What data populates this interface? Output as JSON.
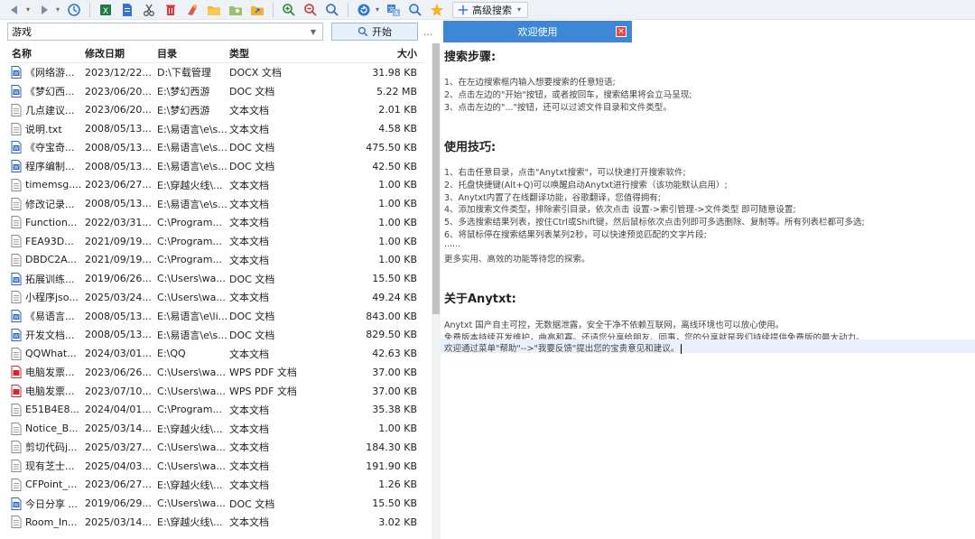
{
  "toolbar": {
    "buttons": [
      {
        "name": "back-icon"
      },
      {
        "name": "forward-icon"
      },
      {
        "name": "history-icon"
      },
      {
        "name": "excel-icon"
      },
      {
        "name": "document-icon"
      },
      {
        "name": "cut-icon"
      },
      {
        "name": "delete-icon"
      },
      {
        "name": "clean-icon"
      },
      {
        "name": "folder-icon"
      },
      {
        "name": "image-folder-icon"
      },
      {
        "name": "export-icon"
      },
      {
        "name": "zoom-in-icon"
      },
      {
        "name": "zoom-out-icon"
      },
      {
        "name": "find-icon"
      },
      {
        "name": "refresh-icon"
      },
      {
        "name": "translate-icon"
      },
      {
        "name": "inspect-icon"
      },
      {
        "name": "favorite-icon"
      }
    ],
    "advanced_search_label": "高级搜索"
  },
  "search": {
    "value": "游戏",
    "start_label": "开始",
    "more_label": "..."
  },
  "tab": {
    "label": "欢迎使用"
  },
  "list": {
    "headers": {
      "name": "名称",
      "date": "修改日期",
      "dir": "目录",
      "type": "类型",
      "size": "大小"
    },
    "rows": [
      {
        "icon": "word",
        "name": "《网络游...",
        "date": "2023/12/22...",
        "dir": "D:\\下载管理",
        "type": "DOCX 文档",
        "size": "31.98 KB"
      },
      {
        "icon": "word",
        "name": "《梦幻西...",
        "date": "2023/06/20...",
        "dir": "E:\\梦幻西游",
        "type": "DOC 文档",
        "size": "5.22 MB"
      },
      {
        "icon": "text",
        "name": "几点建议...",
        "date": "2023/06/20...",
        "dir": "E:\\梦幻西游",
        "type": "文本文档",
        "size": "2.01 KB"
      },
      {
        "icon": "text",
        "name": "说明.txt",
        "date": "2008/05/13...",
        "dir": "E:\\易语言\\e\\s...",
        "type": "文本文档",
        "size": "4.58 KB"
      },
      {
        "icon": "word",
        "name": "《夺宝奇...",
        "date": "2008/05/13...",
        "dir": "E:\\易语言\\e\\s...",
        "type": "DOC 文档",
        "size": "475.50 KB"
      },
      {
        "icon": "word",
        "name": "程序编制...",
        "date": "2008/05/13...",
        "dir": "E:\\易语言\\e\\s...",
        "type": "DOC 文档",
        "size": "42.50 KB"
      },
      {
        "icon": "text",
        "name": "timemsg....",
        "date": "2023/06/27...",
        "dir": "E:\\穿越火线\\...",
        "type": "文本文档",
        "size": "1.00 KB"
      },
      {
        "icon": "text",
        "name": "修改记录...",
        "date": "2008/05/13...",
        "dir": "E:\\易语言\\e\\s...",
        "type": "文本文档",
        "size": "1.00 KB"
      },
      {
        "icon": "text",
        "name": "Function...",
        "date": "2022/03/31...",
        "dir": "C:\\Program...",
        "type": "文本文档",
        "size": "1.00 KB"
      },
      {
        "icon": "text",
        "name": "FEA93D...",
        "date": "2021/09/19...",
        "dir": "C:\\Program...",
        "type": "文本文档",
        "size": "1.00 KB"
      },
      {
        "icon": "text",
        "name": "DBDC2A...",
        "date": "2021/09/19...",
        "dir": "C:\\Program...",
        "type": "文本文档",
        "size": "1.00 KB"
      },
      {
        "icon": "word",
        "name": "拓展训练...",
        "date": "2019/06/26...",
        "dir": "C:\\Users\\wa...",
        "type": "DOC 文档",
        "size": "15.50 KB"
      },
      {
        "icon": "text",
        "name": "小程序jso...",
        "date": "2025/03/24...",
        "dir": "C:\\Users\\wa...",
        "type": "文本文档",
        "size": "49.24 KB"
      },
      {
        "icon": "word",
        "name": "《易语言...",
        "date": "2008/05/13...",
        "dir": "E:\\易语言\\e\\li...",
        "type": "DOC 文档",
        "size": "843.00 KB"
      },
      {
        "icon": "word",
        "name": "开发文档...",
        "date": "2008/05/13...",
        "dir": "E:\\易语言\\e\\s...",
        "type": "DOC 文档",
        "size": "829.50 KB"
      },
      {
        "icon": "text",
        "name": "QQWhat...",
        "date": "2024/03/01...",
        "dir": "E:\\QQ",
        "type": "文本文档",
        "size": "42.63 KB"
      },
      {
        "icon": "pdf",
        "name": "电脑发票...",
        "date": "2023/06/26...",
        "dir": "C:\\Users\\wa...",
        "type": "WPS PDF 文档",
        "size": "37.00 KB"
      },
      {
        "icon": "pdf",
        "name": "电脑发票...",
        "date": "2023/07/10...",
        "dir": "C:\\Users\\wa...",
        "type": "WPS PDF 文档",
        "size": "37.00 KB"
      },
      {
        "icon": "text",
        "name": "E51B4E8...",
        "date": "2024/04/01...",
        "dir": "C:\\Program...",
        "type": "文本文档",
        "size": "35.38 KB"
      },
      {
        "icon": "text",
        "name": "Notice_B...",
        "date": "2025/03/14...",
        "dir": "E:\\穿越火线\\...",
        "type": "文本文档",
        "size": "1.00 KB"
      },
      {
        "icon": "text",
        "name": "剪切代码j...",
        "date": "2025/03/27...",
        "dir": "C:\\Users\\wa...",
        "type": "文本文档",
        "size": "184.30 KB"
      },
      {
        "icon": "text",
        "name": "现有芝士...",
        "date": "2025/04/03...",
        "dir": "C:\\Users\\wa...",
        "type": "文本文档",
        "size": "191.90 KB"
      },
      {
        "icon": "text",
        "name": "CFPoint_...",
        "date": "2023/06/27...",
        "dir": "E:\\穿越火线\\...",
        "type": "文本文档",
        "size": "1.26 KB"
      },
      {
        "icon": "word",
        "name": "今日分享 ...",
        "date": "2019/06/29...",
        "dir": "C:\\Users\\wa...",
        "type": "DOC 文档",
        "size": "15.50 KB"
      },
      {
        "icon": "text",
        "name": "Room_In...",
        "date": "2025/03/14...",
        "dir": "E:\\穿越火线\\...",
        "type": "文本文档",
        "size": "3.02 KB"
      }
    ]
  },
  "content": {
    "steps_title": "搜索步骤:",
    "steps": [
      "1、在左边搜索框内输入想要搜索的任意短语;",
      "2、点击左边的\"开始\"按钮，或者按回车，搜索结果将会立马呈现;",
      "3、点击左边的\"...\"按钮，还可以过滤文件目录和文件类型。"
    ],
    "tips_title": "使用技巧:",
    "tips": [
      "1、右击任意目录，点击\"Anytxt搜索\"，可以快速打开搜索软件;",
      "2、托盘快捷键(Alt+Q)可以唤醒启动Anytxt进行搜索（该功能默认启用）;",
      "3、Anytxt内置了在线翻译功能，谷歌翻译，您值得拥有;",
      "4、添加搜索文件类型，排除索引目录，依次点击 设置->索引管理->文件类型 即可随意设置;",
      "5、多选搜索结果列表，按住Ctrl或Shift键，然后鼠标依次点击列即可多选删除、复制等。所有列表栏都可多选;",
      "6、将鼠标停在搜索结果列表某列2秒，可以快速预览匹配的文字片段;",
      "......",
      "更多实用、高效的功能等待您的探索。"
    ],
    "about_title": "关于Anytxt:",
    "about": [
      "Anytxt 国产自主可控，无数据泄露，安全干净不依赖互联网，离线环境也可以放心使用。",
      "免费版本持续开发维护，曲高和寡。还请您分享给朋友、同事，您的分享就是我们持续提供免费版的最大动力。",
      "欢迎通过菜单\"帮助\"-->\"我要反馈\"提出您的宝贵意见和建议。"
    ]
  },
  "colors": {
    "tab_active": "#3d87d6",
    "word_icon": "#2b65c8",
    "pdf_icon": "#d8262e",
    "text_icon": "#8a8a8a"
  }
}
